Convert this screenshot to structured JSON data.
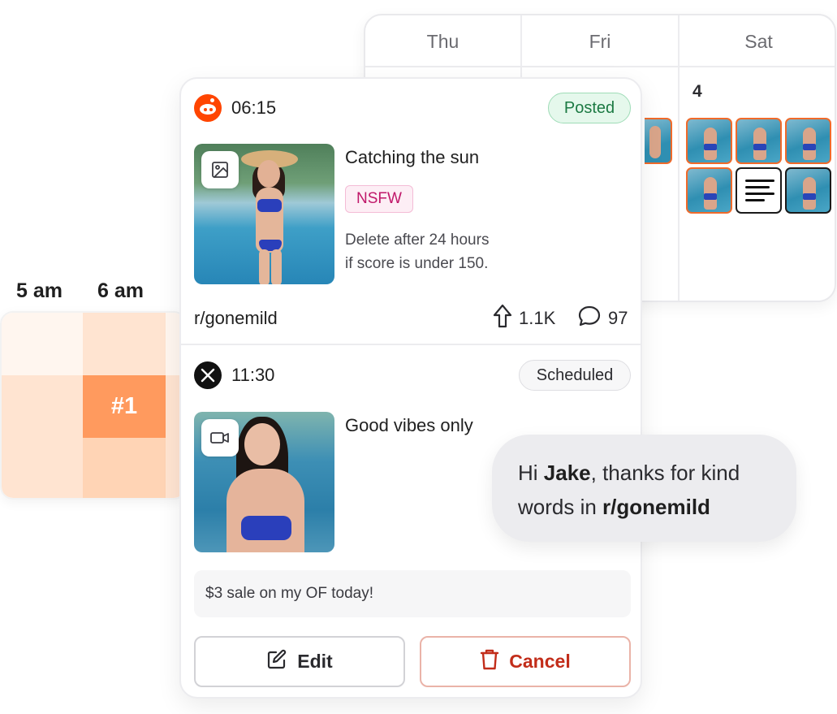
{
  "calendar": {
    "days": [
      "Thu",
      "Fri",
      "Sat"
    ],
    "sat_date": "4"
  },
  "heatmap": {
    "hours": [
      "5 am",
      "6 am"
    ],
    "top_slot_label": "#1",
    "colors": {
      "lightest": "#fff6ef",
      "light": "#ffe4d1",
      "medium": "#ffd4b5",
      "strong": "#ffc899",
      "hot": "#ff9a5e"
    }
  },
  "posts": [
    {
      "platform": "reddit-icon",
      "time": "06:15",
      "status": "Posted",
      "media_type": "image-icon",
      "title": "Catching the sun",
      "tag": "NSFW",
      "rule_line1": "Delete after 24 hours",
      "rule_line2": "if score is under 150.",
      "subreddit": "r/gonemild",
      "upvotes": "1.1K",
      "comments": "97"
    },
    {
      "platform": "x-icon",
      "time": "11:30",
      "status": "Scheduled",
      "media_type": "video-icon",
      "title": "Good vibes only",
      "caption": "$3 sale on my OF today!"
    }
  ],
  "actions": {
    "edit_label": "Edit",
    "cancel_label": "Cancel"
  },
  "chat": {
    "greeting": "Hi ",
    "name": "Jake",
    "mid": ", thanks for kind words in ",
    "subreddit": "r/gonemild"
  },
  "colors": {
    "reddit": "#ff4500",
    "posted_green": "#1c7a43",
    "cancel_red": "#c22d1a",
    "accent_orange": "#f06a2a"
  }
}
